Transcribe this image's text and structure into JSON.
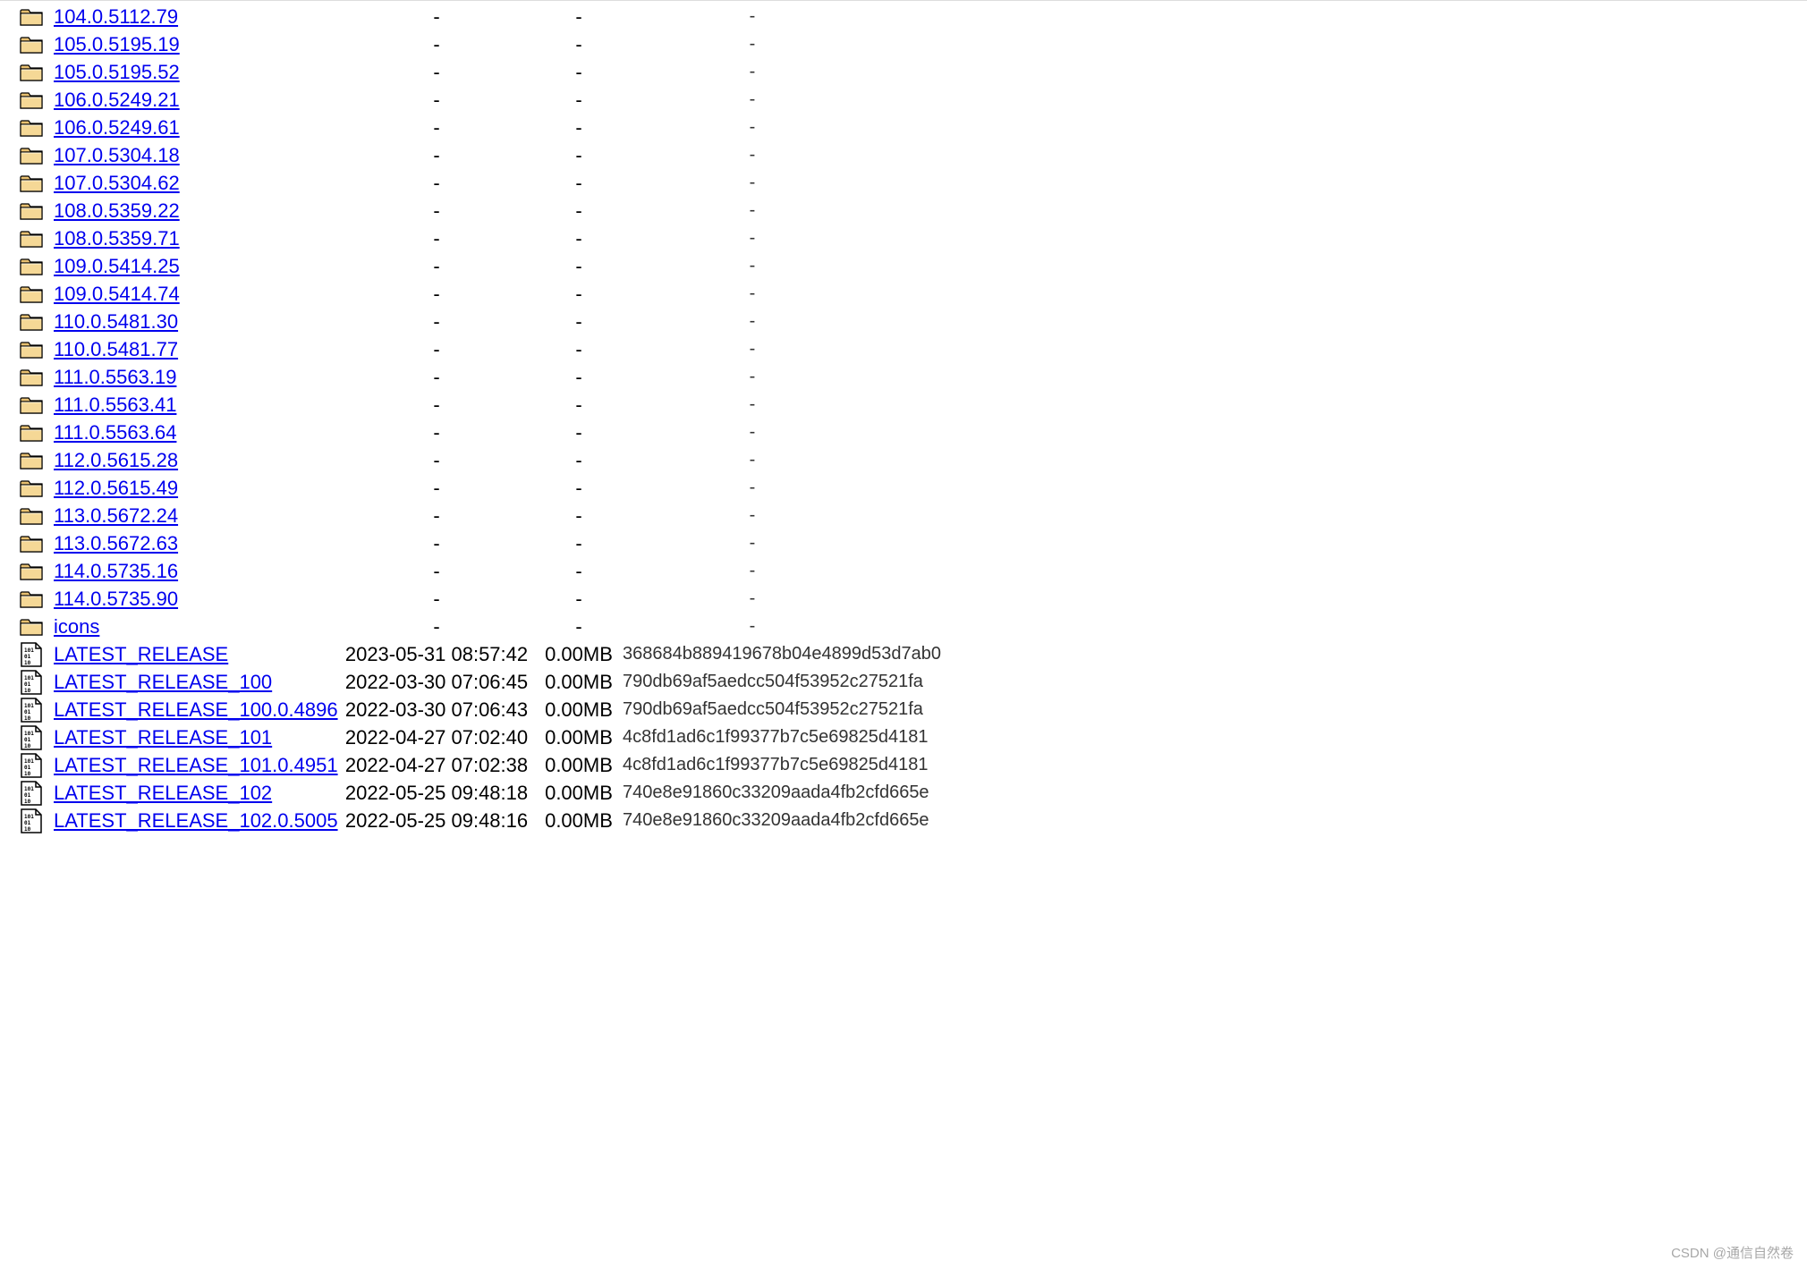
{
  "watermark": "CSDN @通信自然卷",
  "rows": [
    {
      "type": "folder",
      "name": "104.0.5112.79",
      "date": "-",
      "size": "-",
      "hash": "-"
    },
    {
      "type": "folder",
      "name": "105.0.5195.19",
      "date": "-",
      "size": "-",
      "hash": "-"
    },
    {
      "type": "folder",
      "name": "105.0.5195.52",
      "date": "-",
      "size": "-",
      "hash": "-"
    },
    {
      "type": "folder",
      "name": "106.0.5249.21",
      "date": "-",
      "size": "-",
      "hash": "-"
    },
    {
      "type": "folder",
      "name": "106.0.5249.61",
      "date": "-",
      "size": "-",
      "hash": "-"
    },
    {
      "type": "folder",
      "name": "107.0.5304.18",
      "date": "-",
      "size": "-",
      "hash": "-"
    },
    {
      "type": "folder",
      "name": "107.0.5304.62",
      "date": "-",
      "size": "-",
      "hash": "-"
    },
    {
      "type": "folder",
      "name": "108.0.5359.22",
      "date": "-",
      "size": "-",
      "hash": "-"
    },
    {
      "type": "folder",
      "name": "108.0.5359.71",
      "date": "-",
      "size": "-",
      "hash": "-"
    },
    {
      "type": "folder",
      "name": "109.0.5414.25",
      "date": "-",
      "size": "-",
      "hash": "-"
    },
    {
      "type": "folder",
      "name": "109.0.5414.74",
      "date": "-",
      "size": "-",
      "hash": "-"
    },
    {
      "type": "folder",
      "name": "110.0.5481.30",
      "date": "-",
      "size": "-",
      "hash": "-"
    },
    {
      "type": "folder",
      "name": "110.0.5481.77",
      "date": "-",
      "size": "-",
      "hash": "-"
    },
    {
      "type": "folder",
      "name": "111.0.5563.19",
      "date": "-",
      "size": "-",
      "hash": "-"
    },
    {
      "type": "folder",
      "name": "111.0.5563.41",
      "date": "-",
      "size": "-",
      "hash": "-"
    },
    {
      "type": "folder",
      "name": "111.0.5563.64",
      "date": "-",
      "size": "-",
      "hash": "-"
    },
    {
      "type": "folder",
      "name": "112.0.5615.28",
      "date": "-",
      "size": "-",
      "hash": "-"
    },
    {
      "type": "folder",
      "name": "112.0.5615.49",
      "date": "-",
      "size": "-",
      "hash": "-"
    },
    {
      "type": "folder",
      "name": "113.0.5672.24",
      "date": "-",
      "size": "-",
      "hash": "-"
    },
    {
      "type": "folder",
      "name": "113.0.5672.63",
      "date": "-",
      "size": "-",
      "hash": "-"
    },
    {
      "type": "folder",
      "name": "114.0.5735.16",
      "date": "-",
      "size": "-",
      "hash": "-"
    },
    {
      "type": "folder",
      "name": "114.0.5735.90",
      "date": "-",
      "size": "-",
      "hash": "-"
    },
    {
      "type": "folder",
      "name": "icons",
      "date": "-",
      "size": "-",
      "hash": "-"
    },
    {
      "type": "file",
      "name": "LATEST_RELEASE",
      "date": "2023-05-31 08:57:42",
      "size": "0.00MB",
      "hash": "368684b889419678b04e4899d53d7ab0"
    },
    {
      "type": "file",
      "name": "LATEST_RELEASE_100",
      "date": "2022-03-30 07:06:45",
      "size": "0.00MB",
      "hash": "790db69af5aedcc504f53952c27521fa"
    },
    {
      "type": "file",
      "name": "LATEST_RELEASE_100.0.4896",
      "date": "2022-03-30 07:06:43",
      "size": "0.00MB",
      "hash": "790db69af5aedcc504f53952c27521fa"
    },
    {
      "type": "file",
      "name": "LATEST_RELEASE_101",
      "date": "2022-04-27 07:02:40",
      "size": "0.00MB",
      "hash": "4c8fd1ad6c1f99377b7c5e69825d4181"
    },
    {
      "type": "file",
      "name": "LATEST_RELEASE_101.0.4951",
      "date": "2022-04-27 07:02:38",
      "size": "0.00MB",
      "hash": "4c8fd1ad6c1f99377b7c5e69825d4181"
    },
    {
      "type": "file",
      "name": "LATEST_RELEASE_102",
      "date": "2022-05-25 09:48:18",
      "size": "0.00MB",
      "hash": "740e8e91860c33209aada4fb2cfd665e"
    },
    {
      "type": "file",
      "name": "LATEST_RELEASE_102.0.5005",
      "date": "2022-05-25 09:48:16",
      "size": "0.00MB",
      "hash": "740e8e91860c33209aada4fb2cfd665e"
    }
  ]
}
